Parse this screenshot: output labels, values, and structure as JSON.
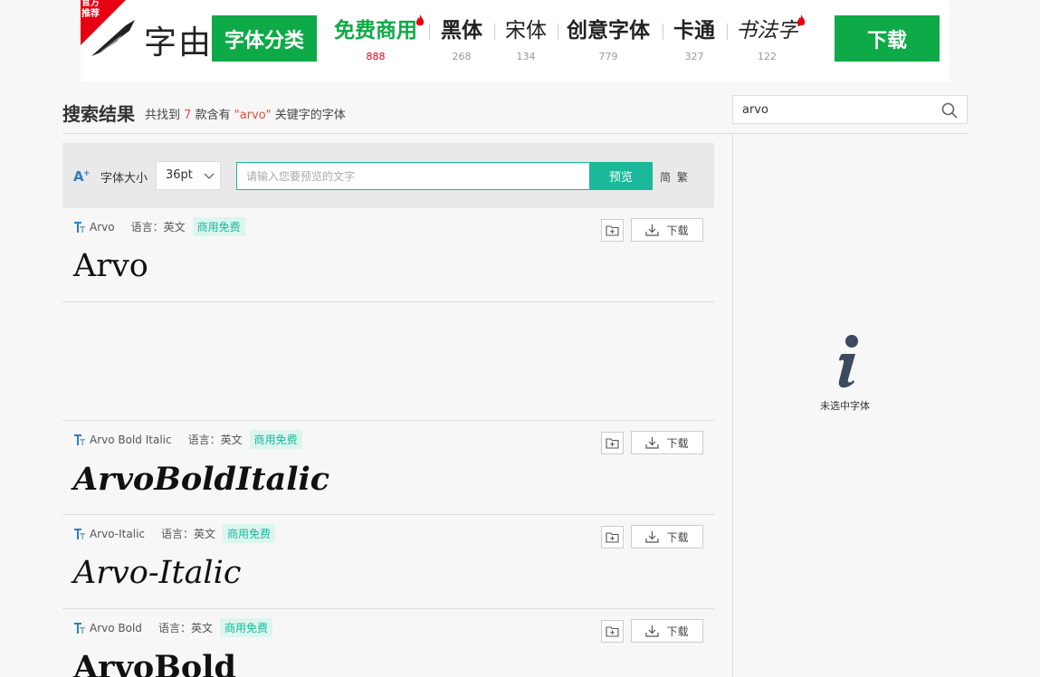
{
  "banner": {
    "corner_label": "官方推荐",
    "logo_text": "字由",
    "category_button": "字体分类",
    "categories": [
      {
        "name": "免费商用",
        "count": "888",
        "hot": true,
        "flame": true
      },
      {
        "name": "黑体",
        "count": "268"
      },
      {
        "name": "宋体",
        "count": "134"
      },
      {
        "name": "创意字体",
        "count": "779"
      },
      {
        "name": "卡通",
        "count": "327"
      },
      {
        "name": "书法字",
        "count": "122",
        "flame": true
      }
    ],
    "download_button": "下载"
  },
  "results": {
    "title": "搜索结果",
    "sub_prefix": "共找到",
    "count": "7",
    "sub_mid": "款含有",
    "keyword": "\"arvo\"",
    "sub_suffix": "关键字的字体"
  },
  "search": {
    "value": "arvo"
  },
  "toolbar": {
    "size_label": "字体大小",
    "size_value": "36pt",
    "preview_placeholder": "请输入您要预览的文字",
    "preview_button": "预览",
    "simplified": "简",
    "traditional": "繁"
  },
  "fonts": [
    {
      "name": "Arvo",
      "language": "语言：英文",
      "tag": "商用免费",
      "download": "下载",
      "sample": "Arvo"
    },
    {
      "name": "Arvo Bold Italic",
      "language": "语言：英文",
      "tag": "商用免费",
      "download": "下载",
      "sample": "ArvoBoldItalic"
    },
    {
      "name": "Arvo-Italic",
      "language": "语言：英文",
      "tag": "商用免费",
      "download": "下载",
      "sample": "Arvo-Italic"
    },
    {
      "name": "Arvo Bold",
      "language": "语言：英文",
      "tag": "商用免费",
      "download": "下载",
      "sample": "ArvoBold"
    }
  ],
  "right_panel": {
    "empty_text": "未选中字体"
  },
  "colors": {
    "brand_green": "#0eaa47",
    "accent_teal": "#19b99a",
    "highlight_red": "#e74c3c"
  }
}
